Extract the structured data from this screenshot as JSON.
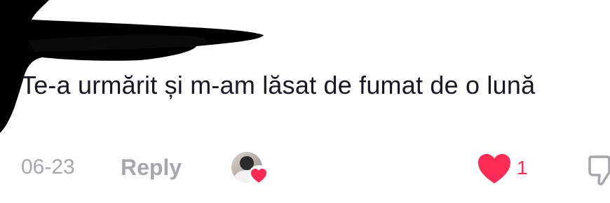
{
  "comment": {
    "text": "Te-a urmărit și m-am lăsat de fumat de o lună"
  },
  "meta": {
    "date": "06-23",
    "reply_label": "Reply",
    "like_count": "1"
  },
  "icons": {
    "like": "heart-icon",
    "dislike": "thumbs-down-icon",
    "creator_liked": "creator-heart-icon",
    "redaction": "redaction-mark"
  },
  "colors": {
    "text": "#161823",
    "muted": "#a6a7ab",
    "like_red": "#fe2c55",
    "redaction": "#000000"
  }
}
